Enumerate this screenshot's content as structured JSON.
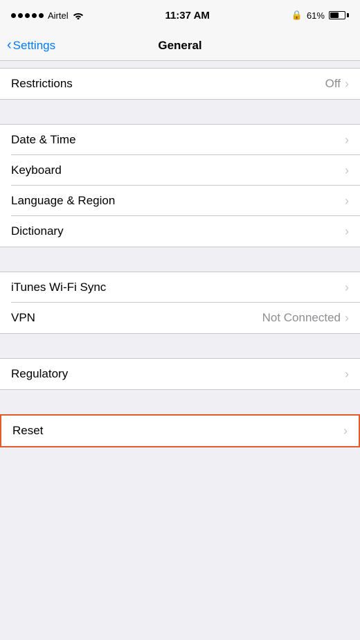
{
  "statusBar": {
    "carrier": "Airtel",
    "time": "11:37 AM",
    "battery": "61%",
    "lockIcon": "🔒"
  },
  "navBar": {
    "backLabel": "Settings",
    "title": "General"
  },
  "sections": [
    {
      "id": "restrictions",
      "rows": [
        {
          "label": "Restrictions",
          "value": "Off",
          "chevron": true
        }
      ]
    },
    {
      "id": "datetime",
      "rows": [
        {
          "label": "Date & Time",
          "value": "",
          "chevron": true
        },
        {
          "label": "Keyboard",
          "value": "",
          "chevron": true
        },
        {
          "label": "Language & Region",
          "value": "",
          "chevron": true
        },
        {
          "label": "Dictionary",
          "value": "",
          "chevron": true
        }
      ]
    },
    {
      "id": "itunes",
      "rows": [
        {
          "label": "iTunes Wi-Fi Sync",
          "value": "",
          "chevron": true
        },
        {
          "label": "VPN",
          "value": "Not Connected",
          "chevron": true
        }
      ]
    },
    {
      "id": "regulatory",
      "rows": [
        {
          "label": "Regulatory",
          "value": "",
          "chevron": true
        }
      ]
    },
    {
      "id": "reset",
      "rows": [
        {
          "label": "Reset",
          "value": "",
          "chevron": true
        }
      ]
    }
  ]
}
